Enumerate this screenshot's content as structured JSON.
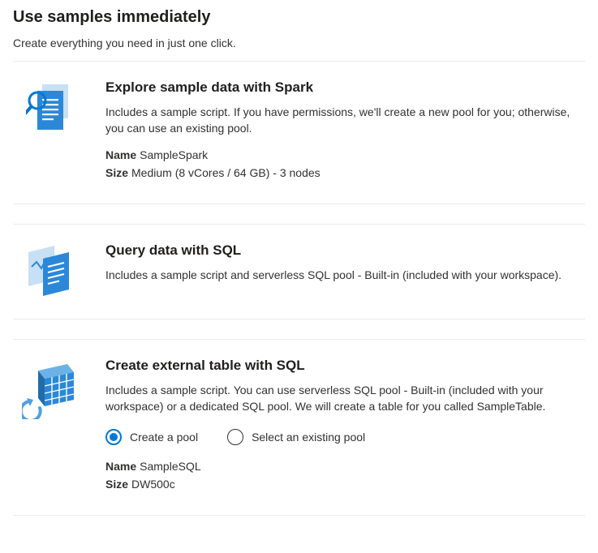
{
  "header": {
    "title": "Use samples immediately",
    "subtitle": "Create everything you need in just one click."
  },
  "cards": [
    {
      "title": "Explore sample data with Spark",
      "description": "Includes a sample script. If you have permissions, we'll create a new pool for you; otherwise, you can use an existing pool.",
      "name_label": "Name",
      "name_value": "SampleSpark",
      "size_label": "Size",
      "size_value": "Medium (8 vCores / 64 GB) - 3 nodes"
    },
    {
      "title": "Query data with SQL",
      "description": "Includes a sample script and serverless SQL pool - Built-in (included with your workspace)."
    },
    {
      "title": "Create external table with SQL",
      "description": "Includes a sample script. You can use serverless SQL pool - Built-in (included with your workspace) or a dedicated SQL pool. We will create a table for you called SampleTable.",
      "radio_options": {
        "create": "Create a pool",
        "select": "Select an existing pool"
      },
      "name_label": "Name",
      "name_value": "SampleSQL",
      "size_label": "Size",
      "size_value": "DW500c"
    }
  ]
}
